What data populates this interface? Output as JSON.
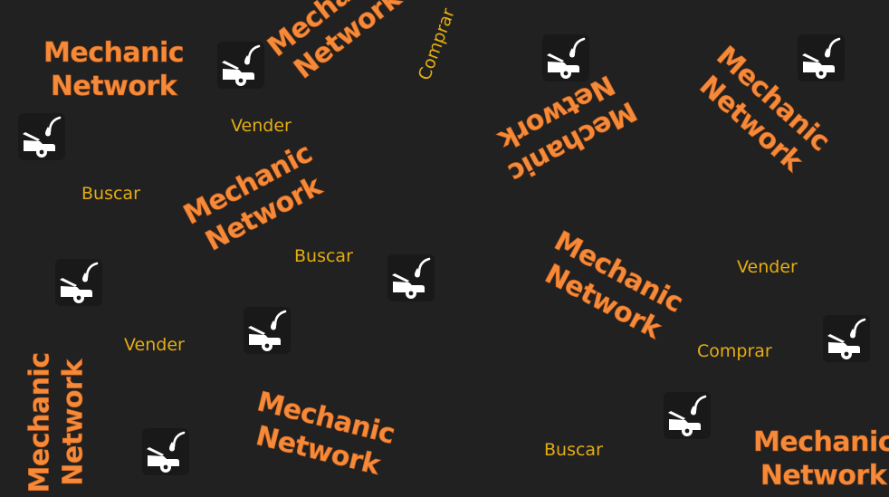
{
  "brand": {
    "line1": "Mechanic",
    "line2": "Network",
    "text_color": "#f58a3a",
    "outline_color": "#c65c18"
  },
  "actions": {
    "buy": "Comprar",
    "sell": "Vender",
    "search": "Buscar",
    "color": "#e3ad12"
  },
  "icon": {
    "name": "car-hood-oil-icon",
    "color": "#ffffff"
  },
  "background_color": "#222121"
}
